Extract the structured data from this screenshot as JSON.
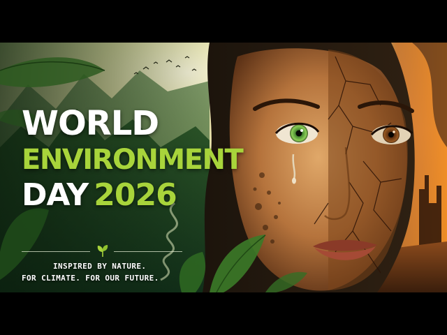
{
  "poster": {
    "headline": {
      "line1": "WORLD",
      "line2": "ENVIRONMENT",
      "line3_day": "DAY",
      "line3_year": "2026"
    },
    "tagline": {
      "line1": "INSPIRED BY NATURE.",
      "line2": "FOR CLIMATE. FOR OUR FUTURE."
    },
    "colors": {
      "accent_green": "#a8d43b",
      "text_white": "#ffffff",
      "letterbox": "#000000",
      "forest_dark": "#0f2510",
      "sky_glow": "#f3ecb0",
      "smoke_orange": "#e0711c"
    },
    "icons": {
      "divider_leaf": "sprout-icon"
    }
  }
}
